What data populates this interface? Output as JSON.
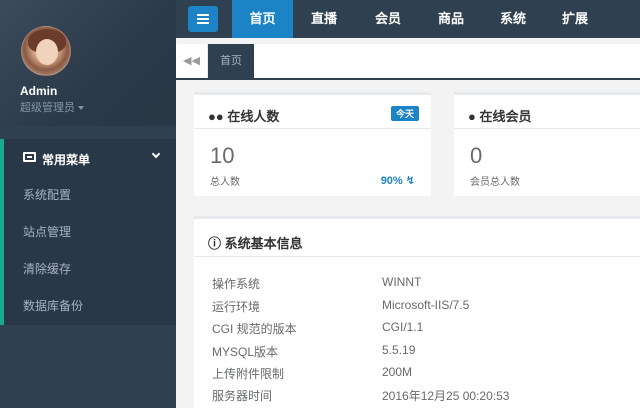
{
  "profile": {
    "name": "Admin",
    "role": "超级管理员"
  },
  "nav": {
    "section_label": "常用菜单",
    "items": [
      "系统配置",
      "站点管理",
      "清除缓存",
      "数据库备份"
    ]
  },
  "topnav": {
    "items": [
      "首页",
      "直播",
      "会员",
      "商品",
      "系统",
      "扩展"
    ],
    "active_index": 0
  },
  "tabs": {
    "items": [
      "首页"
    ]
  },
  "online_users": {
    "title": "在线人数",
    "badge": "今天",
    "value": "10",
    "label": "总人数",
    "percent": "90%"
  },
  "online_members": {
    "title": "在线会员",
    "value": "0",
    "label": "会员总人数"
  },
  "sysinfo": {
    "title": "系统基本信息",
    "rows": [
      {
        "key": "操作系统",
        "value": "WINNT"
      },
      {
        "key": "运行环境",
        "value": "Microsoft-IIS/7.5"
      },
      {
        "key": "CGI 规范的版本",
        "value": "CGI/1.1"
      },
      {
        "key": "MYSQL版本",
        "value": "5.5.19"
      },
      {
        "key": "上传附件限制",
        "value": "200M"
      },
      {
        "key": "服务器时间",
        "value": "2016年12月25 00:20:53"
      }
    ]
  },
  "colors": {
    "sidebar": "#2f4050",
    "accent": "#1c84c6",
    "nav_marker": "#19aa8d"
  }
}
